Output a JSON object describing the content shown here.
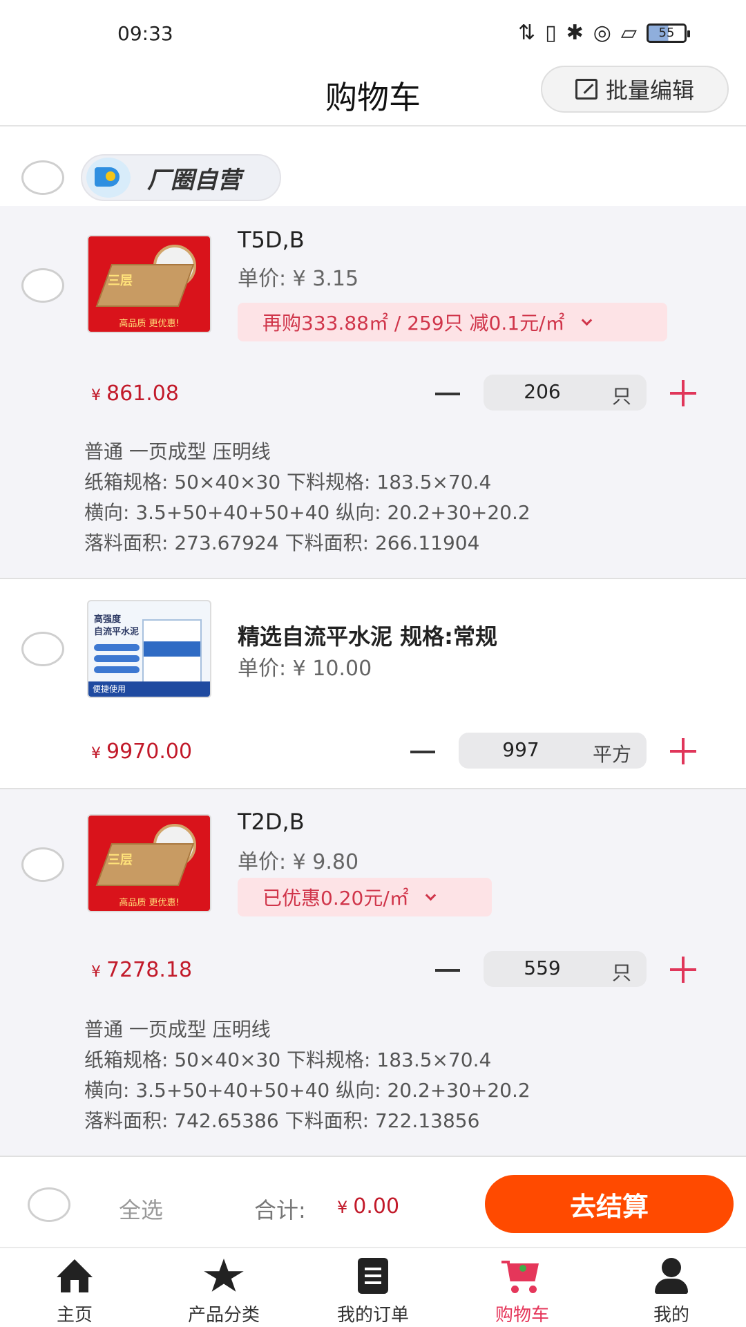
{
  "status_bar": {
    "time": "09:33",
    "battery": "55"
  },
  "header": {
    "title": "购物车",
    "batch_edit": "批量编辑"
  },
  "shop": {
    "name": "厂圈自营"
  },
  "items": [
    {
      "title": "T5D,B",
      "unit_price_label": "单价:",
      "unit_price": "¥ 3.15",
      "promo": "再购333.88㎡ / 259只 减0.1元/㎡",
      "subtotal": "861.08",
      "quantity": "206",
      "unit": "只",
      "thumb_text": [
        "三层",
        "高品质 更优惠!"
      ],
      "specs": [
        "普通 一页成型 压明线",
        "纸箱规格: 50×40×30 下料规格: 183.5×70.4",
        "横向: 3.5+50+40+50+40 纵向: 20.2+30+20.2",
        "落料面积: 273.67924 下料面积: 266.11904"
      ]
    },
    {
      "title": "精选自流平水泥 规格:常规",
      "unit_price_label": "单价:",
      "unit_price": "¥ 10.00",
      "subtotal": "9970.00",
      "quantity": "997",
      "unit": "平方",
      "thumb_text": [
        "高强度",
        "自流平水泥",
        "便捷使用"
      ]
    },
    {
      "title": "T2D,B",
      "unit_price_label": "单价:",
      "unit_price": "¥ 9.80",
      "promo": "已优惠0.20元/㎡",
      "subtotal": "7278.18",
      "quantity": "559",
      "unit": "只",
      "thumb_text": [
        "三层",
        "高品质 更优惠!"
      ],
      "specs": [
        "普通 一页成型 压明线",
        "纸箱规格: 50×40×30 下料规格: 183.5×70.4",
        "横向: 3.5+50+40+50+40 纵向: 20.2+30+20.2",
        "落料面积: 742.65386 下料面积: 722.13856"
      ]
    }
  ],
  "currency": "¥",
  "checkout": {
    "select_all": "全选",
    "total_label": "合计:",
    "total_value": "0.00",
    "button": "去结算"
  },
  "tabs": [
    {
      "label": "主页",
      "icon": "home-icon"
    },
    {
      "label": "产品分类",
      "icon": "star-icon"
    },
    {
      "label": "我的订单",
      "icon": "order-icon"
    },
    {
      "label": "购物车",
      "icon": "cart-icon",
      "active": true
    },
    {
      "label": "我的",
      "icon": "user-icon"
    }
  ],
  "colors": {
    "accent": "#e5365a",
    "price": "#c21a2a",
    "checkout_button": "#ff4a00"
  }
}
